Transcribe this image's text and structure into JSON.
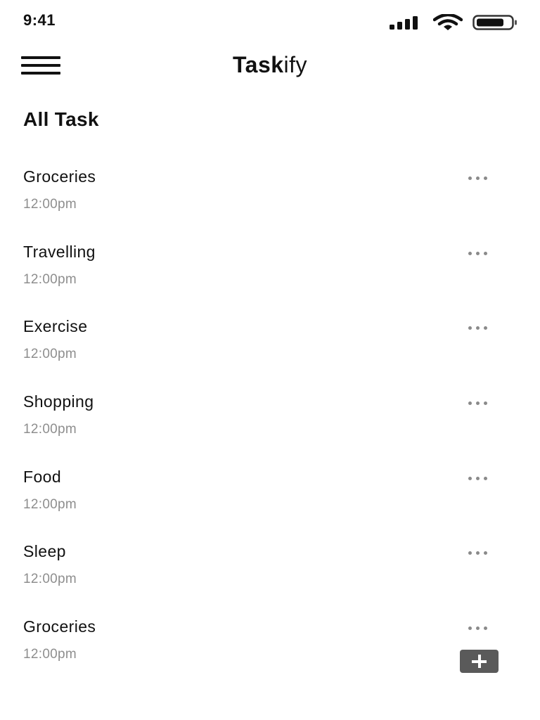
{
  "status_bar": {
    "time": "9:41",
    "icons": [
      "signal-icon",
      "wifi-icon",
      "battery-icon"
    ]
  },
  "header": {
    "title_bold": "Task",
    "title_light": "ify",
    "menu_icon": "hamburger-menu-icon"
  },
  "section": {
    "title": "All Task"
  },
  "tasks": [
    {
      "name": "Groceries",
      "time": "12:00pm"
    },
    {
      "name": "Travelling",
      "time": "12:00pm"
    },
    {
      "name": "Exercise",
      "time": "12:00pm"
    },
    {
      "name": "Shopping",
      "time": "12:00pm"
    },
    {
      "name": "Food",
      "time": "12:00pm"
    },
    {
      "name": "Sleep",
      "time": "12:00pm"
    },
    {
      "name": "Groceries",
      "time": "12:00pm"
    }
  ],
  "task_menu_icon": "more-horizontal-icon",
  "fab": {
    "icon": "plus-icon",
    "color": "#5a5a5a"
  },
  "colors": {
    "text_primary": "#111111",
    "text_secondary": "#8e8e8e",
    "background": "#ffffff"
  }
}
